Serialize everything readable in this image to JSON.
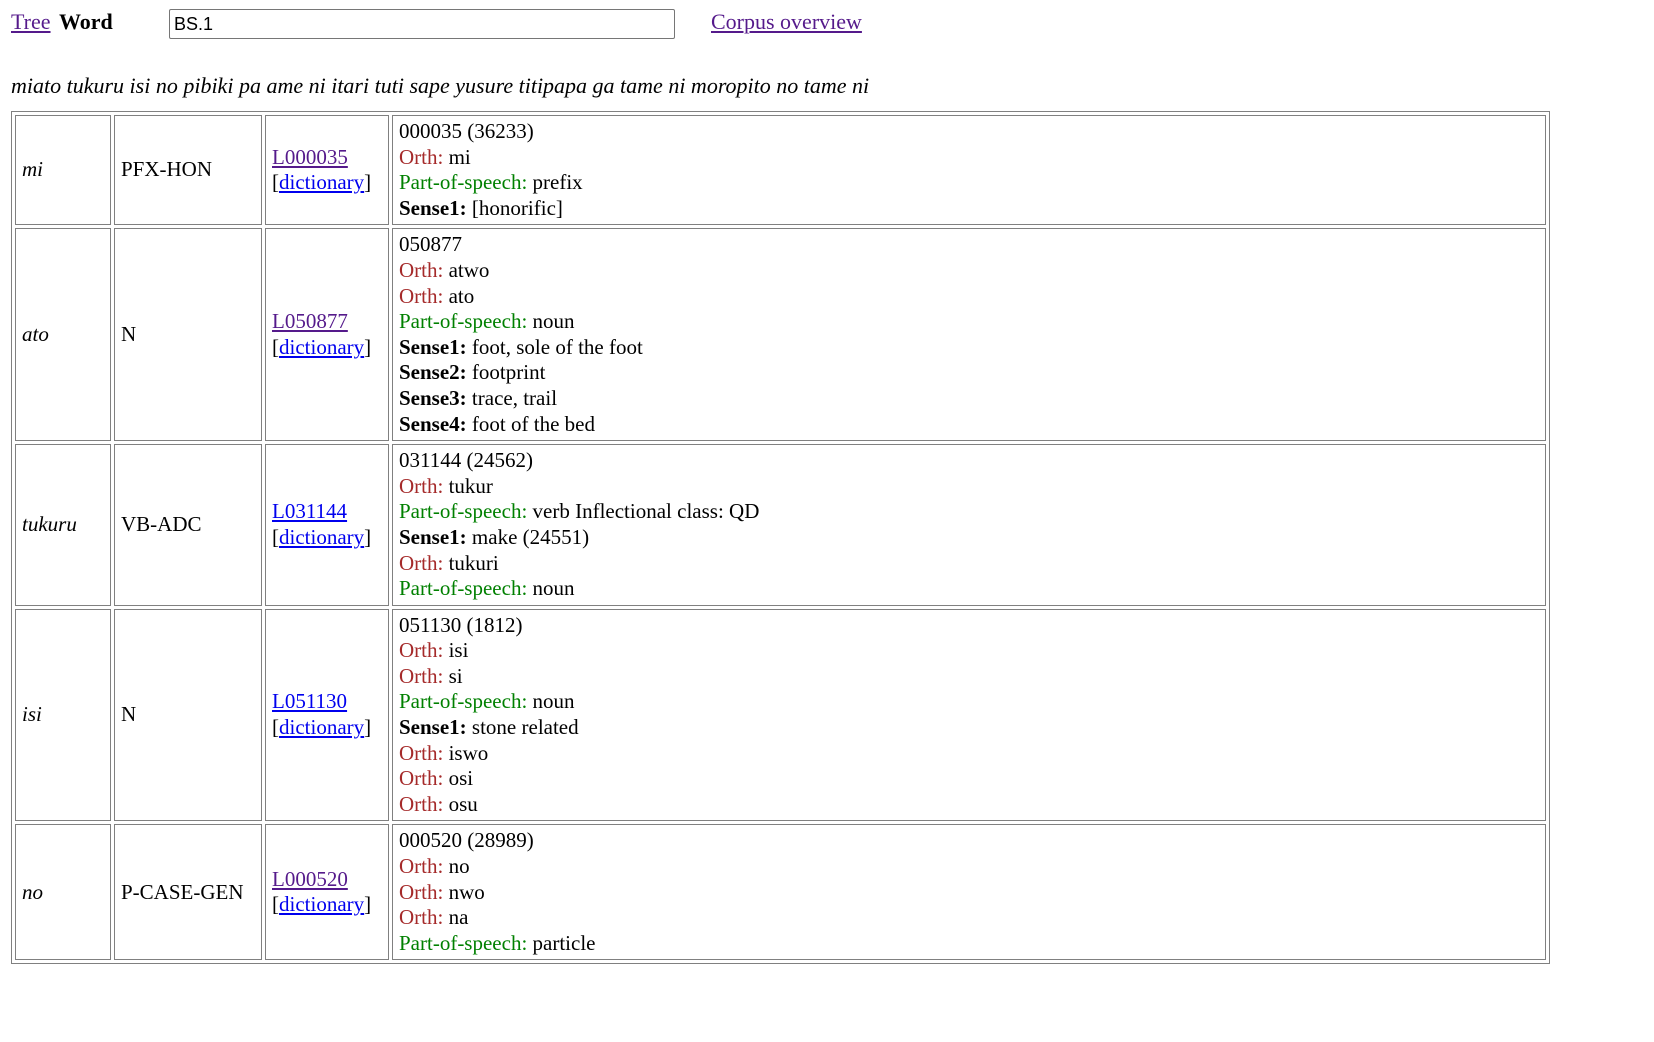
{
  "nav": {
    "tree_label": "Tree",
    "word_label": "Word",
    "search_value": "BS.1",
    "corpus_label": "Corpus overview"
  },
  "sentence": "miato tukuru isi no pibiki pa ame ni itari tuti sape yusure titipapa ga tame ni moropito no tame ni",
  "rows": [
    {
      "form": "mi",
      "tag": "PFX-HON",
      "lemma_id": "L000035",
      "dict_label": "dictionary",
      "lines": [
        {
          "label": "",
          "text": "000035 (36233)",
          "kind": "plain"
        },
        {
          "label": "Orth:",
          "text": "mi",
          "kind": "orth"
        },
        {
          "label": "Part-of-speech:",
          "text": "prefix",
          "kind": "pos"
        },
        {
          "label": "Sense1:",
          "text": "[honorific]",
          "kind": "sense"
        }
      ]
    },
    {
      "form": "ato",
      "tag": "N",
      "lemma_id": "L050877",
      "dict_label": "dictionary",
      "lines": [
        {
          "label": "",
          "text": "050877",
          "kind": "plain"
        },
        {
          "label": "Orth:",
          "text": "atwo",
          "kind": "orth"
        },
        {
          "label": "Orth:",
          "text": "ato",
          "kind": "orth"
        },
        {
          "label": "Part-of-speech:",
          "text": "noun",
          "kind": "pos"
        },
        {
          "label": "Sense1:",
          "text": "foot, sole of the foot",
          "kind": "sense"
        },
        {
          "label": "Sense2:",
          "text": "footprint",
          "kind": "sense"
        },
        {
          "label": "Sense3:",
          "text": "trace, trail",
          "kind": "sense"
        },
        {
          "label": "Sense4:",
          "text": "foot of the bed",
          "kind": "sense"
        }
      ]
    },
    {
      "form": "tukuru",
      "tag": "VB-ADC",
      "lemma_id": "L031144",
      "dict_label": "dictionary",
      "lines": [
        {
          "label": "",
          "text": "031144 (24562)",
          "kind": "plain"
        },
        {
          "label": "Orth:",
          "text": "tukur",
          "kind": "orth"
        },
        {
          "label": "Part-of-speech:",
          "text": "verb Inflectional class: QD",
          "kind": "pos"
        },
        {
          "label": "Sense1:",
          "text": "make (24551)",
          "kind": "sense"
        },
        {
          "label": "Orth:",
          "text": "tukuri",
          "kind": "orth"
        },
        {
          "label": "Part-of-speech:",
          "text": "noun",
          "kind": "pos"
        }
      ]
    },
    {
      "form": "isi",
      "tag": "N",
      "lemma_id": "L051130",
      "dict_label": "dictionary",
      "lines": [
        {
          "label": "",
          "text": "051130 (1812)",
          "kind": "plain"
        },
        {
          "label": "Orth:",
          "text": "isi",
          "kind": "orth"
        },
        {
          "label": "Orth:",
          "text": "si",
          "kind": "orth"
        },
        {
          "label": "Part-of-speech:",
          "text": "noun",
          "kind": "pos"
        },
        {
          "label": "Sense1:",
          "text": "stone related",
          "kind": "sense"
        },
        {
          "label": "Orth:",
          "text": "iswo",
          "kind": "orth"
        },
        {
          "label": "Orth:",
          "text": "osi",
          "kind": "orth"
        },
        {
          "label": "Orth:",
          "text": "osu",
          "kind": "orth"
        }
      ]
    },
    {
      "form": "no",
      "tag": "P-CASE-GEN",
      "lemma_id": "L000520",
      "dict_label": "dictionary",
      "lines": [
        {
          "label": "",
          "text": "000520 (28989)",
          "kind": "plain"
        },
        {
          "label": "Orth:",
          "text": "no",
          "kind": "orth"
        },
        {
          "label": "Orth:",
          "text": "nwo",
          "kind": "orth"
        },
        {
          "label": "Orth:",
          "text": "na",
          "kind": "orth"
        },
        {
          "label": "Part-of-speech:",
          "text": "particle",
          "kind": "pos"
        }
      ]
    }
  ]
}
